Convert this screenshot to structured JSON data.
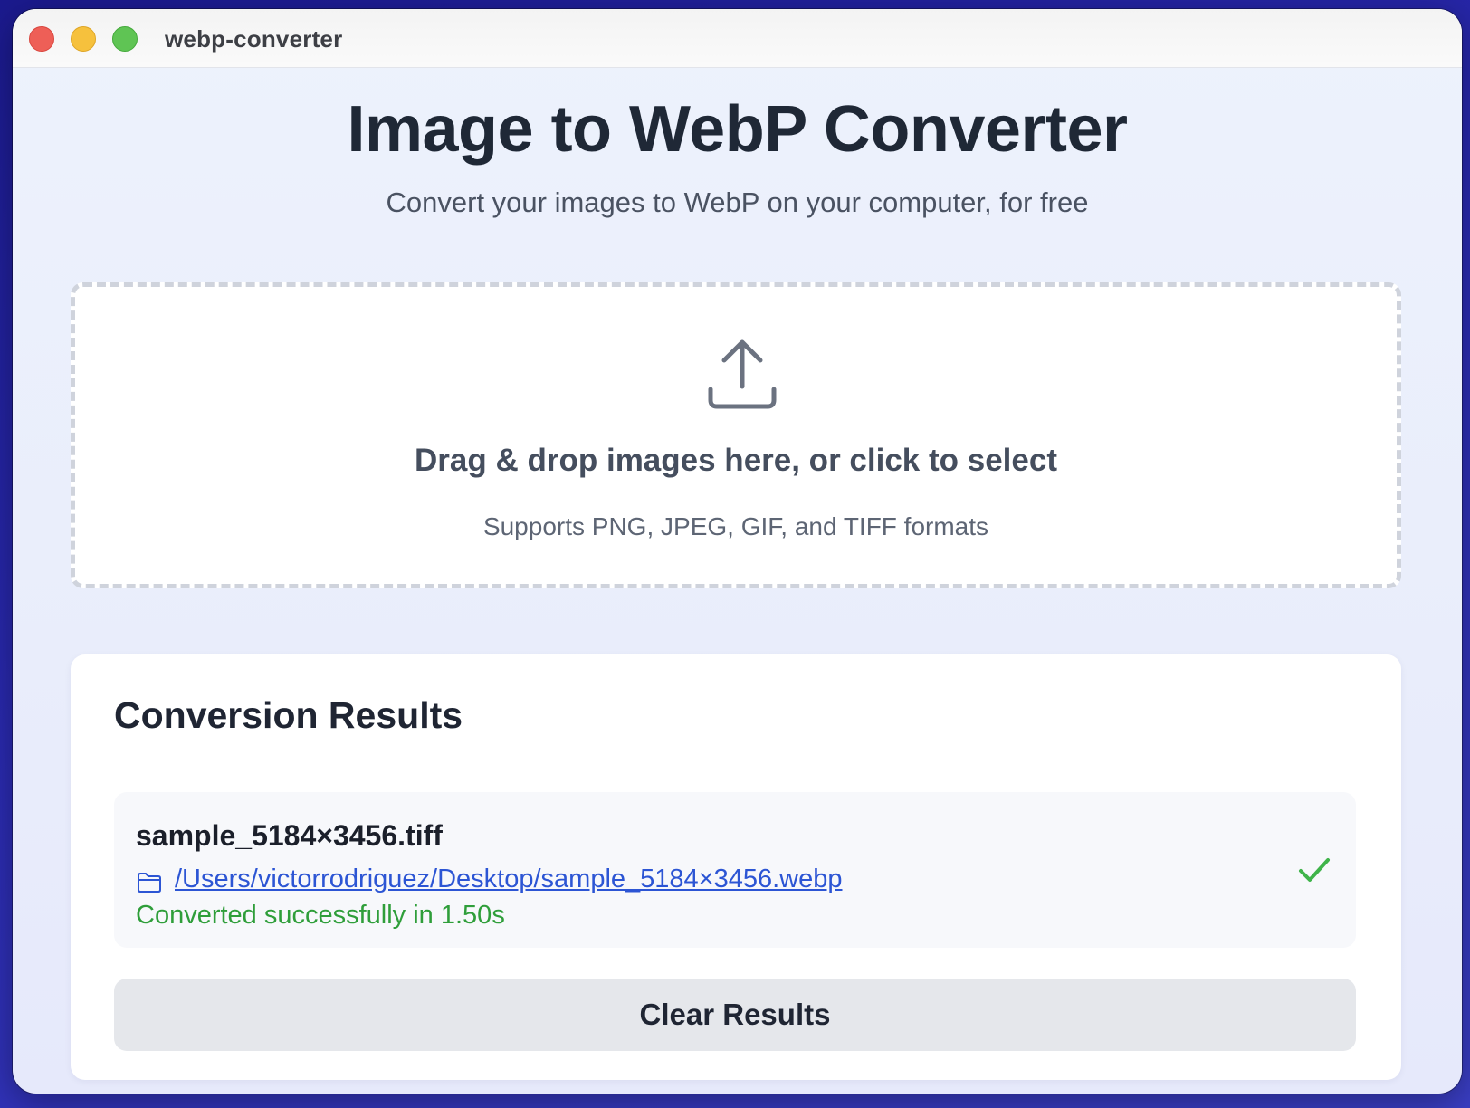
{
  "window": {
    "title": "webp-converter"
  },
  "header": {
    "title": "Image to WebP Converter",
    "subtitle": "Convert your images to WebP on your computer, for free"
  },
  "dropzone": {
    "title": "Drag & drop images here, or click to select",
    "hint": "Supports PNG, JPEG, GIF, and TIFF formats",
    "icon": "upload-icon"
  },
  "results": {
    "title": "Conversion Results",
    "items": [
      {
        "file_name": "sample_5184×3456.tiff",
        "output_path": "/Users/victorrodriguez/Desktop/sample_5184×3456.webp",
        "status": "Converted successfully in 1.50s",
        "status_icon": "check-icon",
        "path_icon": "folder-icon"
      }
    ],
    "clear_label": "Clear Results"
  },
  "colors": {
    "accent_link": "#2c55d4",
    "success": "#2f9e3a",
    "traffic_red": "#ee5f57",
    "traffic_yellow": "#f6c13d",
    "traffic_green": "#5fc454"
  }
}
